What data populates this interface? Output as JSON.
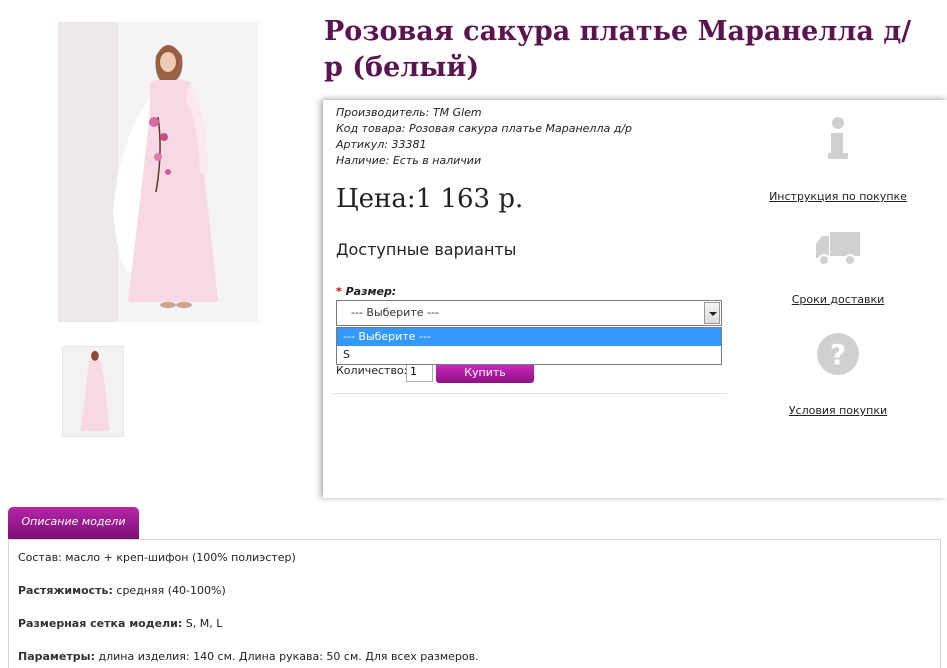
{
  "product": {
    "title": "Розовая сакура платье Маранелла д/р (белый)",
    "manufacturer_label": "Производитель:",
    "manufacturer": "TM Glem",
    "code_label": "Код товара:",
    "code": "Розовая сакура платье Маранелла д/р",
    "sku_label": "Артикул:",
    "sku": "33381",
    "stock_label": "Наличие:",
    "stock": "Есть в наличии",
    "price": "Цена:1 163 р."
  },
  "options": {
    "heading": "Доступные варианты",
    "size_required": "*",
    "size_label": "Размер:",
    "selected": "--- Выберите ---",
    "list": [
      "--- Выберите ---",
      "S"
    ]
  },
  "cart": {
    "qty_label": "Количество:",
    "qty_value": "1",
    "buy_label": "Купить"
  },
  "side": {
    "instruction": "Инструкция по покупке",
    "delivery": "Сроки доставки",
    "conditions": "Условия покупки"
  },
  "tabs": {
    "description": "Описание модели"
  },
  "description": {
    "composition_label": "Состав:",
    "composition": "масло + креп-шифон (100% полиэстер)",
    "stretch_label": "Растяжимость:",
    "stretch": "средняя (40-100%)",
    "sizes_label": "Размерная сетка модели:",
    "sizes": "S, M, L",
    "params_label": "Параметры:",
    "params": "длина изделия: 140 см. Длина рукава: 50 см. Для всех размеров."
  },
  "colors": {
    "title": "#5b1450",
    "accent": "#b526a8",
    "select_highlight": "#3399ff"
  },
  "icons": [
    "info-icon",
    "truck-icon",
    "question-icon"
  ]
}
